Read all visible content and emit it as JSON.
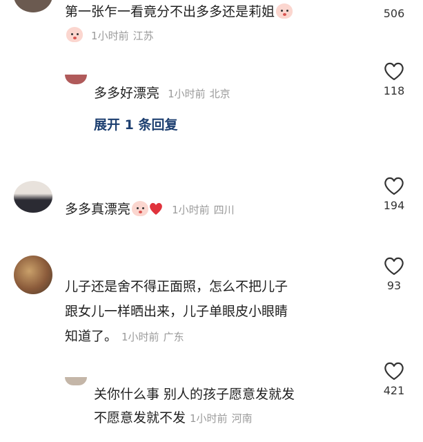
{
  "comments": [
    {
      "text": "第一张乍一看竟分不出多多还是莉姐",
      "time": "1小时前",
      "location": "江苏",
      "likes": "506"
    },
    {
      "text": "多多好漂亮",
      "time": "1小时前",
      "location": "北京",
      "likes": "118",
      "expand_label": "展开 1 条回复"
    },
    {
      "text": "多多真漂亮",
      "time": "1小时前",
      "location": "四川",
      "likes": "194"
    },
    {
      "lines": [
        "儿子还是舍不得正面照，怎么不把儿子",
        "跟女儿一样晒出来，儿子单眼皮小眼睛",
        "知道了。"
      ],
      "time": "1小时前",
      "location": "广东",
      "likes": "93"
    },
    {
      "lines": [
        "关你什么事 别人的孩子愿意发就发",
        "不愿意发就不发"
      ],
      "time": "1小时前",
      "location": "河南",
      "likes": "421"
    }
  ],
  "icons": {
    "like": "heart-outline-icon",
    "emoji_face": "peach-face-emoji",
    "emoji_heart": "red-heart-emoji"
  },
  "colors": {
    "text": "#1f1f1f",
    "meta": "#9a9a9a",
    "link": "#1d3f70",
    "heart_emoji": "#e0333c"
  }
}
